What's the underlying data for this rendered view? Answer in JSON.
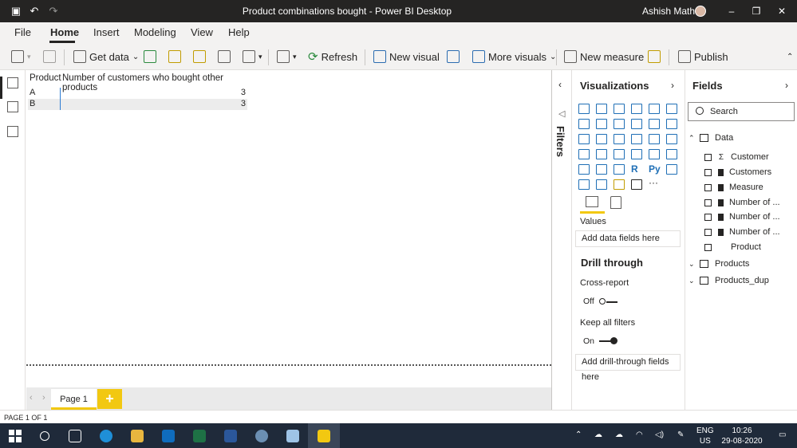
{
  "window": {
    "title": "Product combinations bought - Power BI Desktop",
    "user": "Ashish Mathur"
  },
  "menu": {
    "tabs": [
      "File",
      "Home",
      "Insert",
      "Modeling",
      "View",
      "Help"
    ],
    "active": "Home"
  },
  "ribbon": {
    "get_data": "Get data",
    "refresh": "Refresh",
    "new_visual": "New visual",
    "more_visuals": "More visuals",
    "new_measure": "New measure",
    "publish": "Publish"
  },
  "table_visual": {
    "columns": [
      "Product",
      "Number of customers who bought other products"
    ],
    "rows": [
      {
        "product": "A",
        "value": "3"
      },
      {
        "product": "B",
        "value": "3"
      }
    ]
  },
  "filters": {
    "label": "Filters"
  },
  "visualizations": {
    "title": "Visualizations",
    "values_label": "Values",
    "values_placeholder": "Add data fields here",
    "drill_through_title": "Drill through",
    "cross_report_label": "Cross-report",
    "cross_report_state": "Off",
    "keep_filters_label": "Keep all filters",
    "keep_filters_state": "On",
    "drill_placeholder": "Add drill-through fields here",
    "r_label": "R",
    "py_label": "Py",
    "more_label": "···"
  },
  "fields": {
    "title": "Fields",
    "search_placeholder": "Search",
    "tables": [
      {
        "name": "Data",
        "expanded": true,
        "items": [
          {
            "label": "Customer",
            "type": "Σ"
          },
          {
            "label": "Customers",
            "type": "calc"
          },
          {
            "label": "Measure",
            "type": "calc"
          },
          {
            "label": "Number of ...",
            "type": "calc"
          },
          {
            "label": "Number of ...",
            "type": "calc"
          },
          {
            "label": "Number of ...",
            "type": "calc"
          },
          {
            "label": "Product",
            "type": ""
          }
        ]
      },
      {
        "name": "Products",
        "expanded": false
      },
      {
        "name": "Products_dup",
        "expanded": false
      }
    ]
  },
  "pages": {
    "tabs": [
      "Page 1"
    ],
    "add_label": "+"
  },
  "status": {
    "text": "PAGE 1 OF 1"
  },
  "taskbar": {
    "lang_line1": "ENG",
    "lang_line2": "US",
    "time": "10:26",
    "date": "29-08-2020"
  },
  "colors": {
    "accent_yellow": "#f2c811",
    "title_bar": "#252423",
    "taskbar": "#1f2a3a",
    "visual_icon_blue": "#1f6fb6"
  }
}
